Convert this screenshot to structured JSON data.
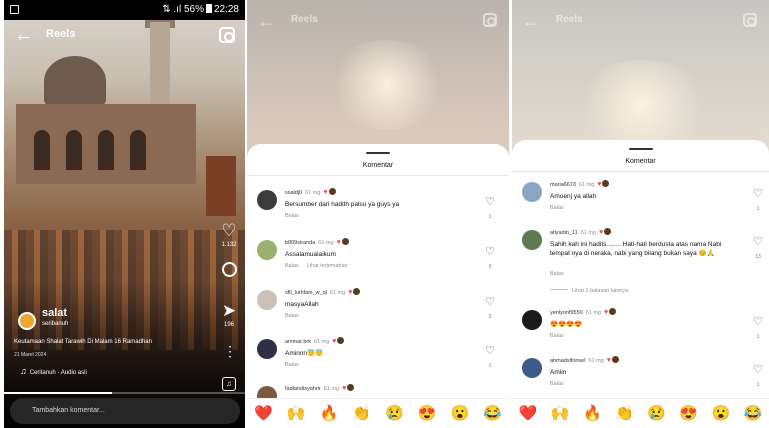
{
  "reels": {
    "status": {
      "signal": "⇅ .ıl",
      "battery": "56%",
      "time": "22:28"
    },
    "title": "Reels",
    "actions": {
      "like_count": "1.132",
      "share_count": "196"
    },
    "channel": {
      "name": "salat",
      "subtitle": "seribanuh"
    },
    "caption": "Keutamaan Shalat Tarawih Di Malam 16 Ramadhan",
    "date": "21 Maret 2024",
    "audio": "Ceritanuh · Audio asli",
    "progress": 0.45,
    "add_comment_placeholder": "Tambahkan komentar..."
  },
  "sheet_title": "Komentar",
  "reply_label": "Balas",
  "panel2": {
    "title": "Reels",
    "comments": [
      {
        "user": "ssaldj0",
        "ago": "61 mg",
        "text": "Bersumber dari hadith palsu ya guys ya",
        "likes": "1",
        "avatar_color": "#3b3b3b"
      },
      {
        "user": "b809siranda",
        "ago": "61 mg",
        "text": "Assalamualaikum",
        "likes": "3",
        "see_translation": "Lihat terjemahan",
        "avatar_color": "#9bb06f"
      },
      {
        "user": "sfil_luthfani_w_ql",
        "ago": "61 mg",
        "text": "masyaAllah",
        "likes": "3",
        "avatar_color": "#c9c1b8"
      },
      {
        "user": "ammar.brk",
        "ago": "61 mg",
        "text": "Aminnn😇😇",
        "likes": "1",
        "avatar_color": "#2f2f46"
      },
      {
        "user": "fadlandisyahrir",
        "ago": "61 mg",
        "text": "",
        "likes": "",
        "avatar_color": "#7a5a40"
      }
    ]
  },
  "panel3": {
    "title": "Reels",
    "comments": [
      {
        "user": "maria6673",
        "ago": "61 mg",
        "text": "Amoenj ya allah",
        "likes": "1",
        "avatar_color": "#89a6c0"
      },
      {
        "user": "atiyadin_11",
        "ago": "61 mg",
        "text": "Sahih kah ini hadits........ Hati-hati berdusta atas nama Nabi tempat nya di neraka, nabi yang bilang bukan saya 😊🙏",
        "likes": "13",
        "avatar_color": "#5f7a52"
      },
      {
        "user": "yenlyonf9550",
        "ago": "61 mg",
        "text": "😍😍😍😍",
        "likes": "1",
        "avatar_color": "#1a1a1a"
      },
      {
        "user": "ahmadsifonsel",
        "ago": "61 mg",
        "text": "Amiin",
        "likes": "1",
        "avatar_color": "#3c5a8a"
      }
    ],
    "view_replies": "Lihat 1 balasan lainnya"
  },
  "emoji_bar": [
    "❤️",
    "🙌",
    "🔥",
    "👏",
    "😢",
    "😍",
    "😮",
    "😂"
  ],
  "colors": {
    "heart": "#ed4956",
    "secondary_text": "#8e8e8e",
    "sheet_bg": "#ffffff"
  }
}
